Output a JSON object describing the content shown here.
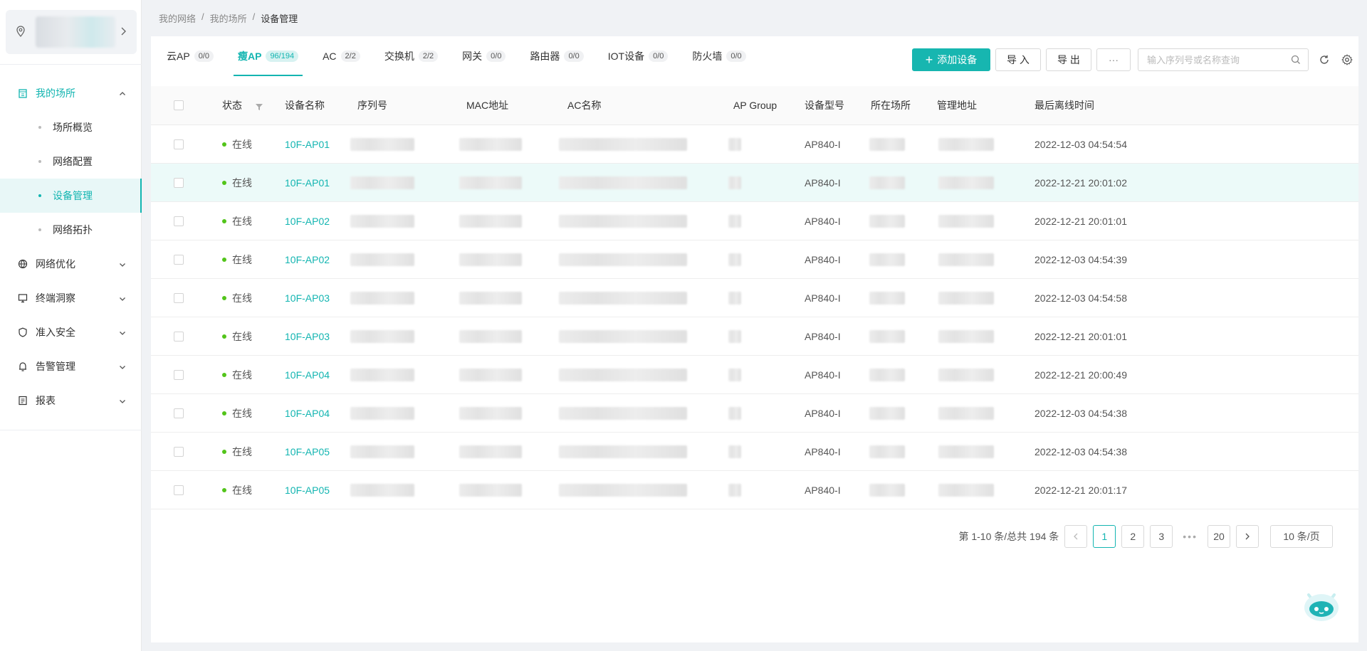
{
  "breadcrumb": [
    "我的网络",
    "我的场所",
    "设备管理"
  ],
  "sidebar": {
    "groups": [
      {
        "label": "我的场所",
        "icon": "building-icon",
        "open": true,
        "items": [
          "场所概览",
          "网络配置",
          "设备管理",
          "网络拓扑"
        ],
        "active": "设备管理"
      },
      {
        "label": "网络优化",
        "icon": "globe-icon"
      },
      {
        "label": "终端洞察",
        "icon": "monitor-icon"
      },
      {
        "label": "准入安全",
        "icon": "shield-icon"
      },
      {
        "label": "告警管理",
        "icon": "bell-icon"
      },
      {
        "label": "报表",
        "icon": "report-icon"
      }
    ]
  },
  "tabs": [
    {
      "label": "云AP",
      "count": "0/0"
    },
    {
      "label": "瘦AP",
      "count": "96/194",
      "active": true
    },
    {
      "label": "AC",
      "count": "2/2"
    },
    {
      "label": "交换机",
      "count": "2/2"
    },
    {
      "label": "网关",
      "count": "0/0"
    },
    {
      "label": "路由器",
      "count": "0/0"
    },
    {
      "label": "IOT设备",
      "count": "0/0"
    },
    {
      "label": "防火墙",
      "count": "0/0"
    }
  ],
  "toolbar": {
    "add_label": "添加设备",
    "import_label": "导 入",
    "export_label": "导 出",
    "more_label": "···",
    "search_placeholder": "输入序列号或名称查询"
  },
  "table": {
    "columns": [
      "状态",
      "设备名称",
      "序列号",
      "MAC地址",
      "AC名称",
      "AP Group",
      "设备型号",
      "所在场所",
      "管理地址",
      "最后离线时间"
    ],
    "rows": [
      {
        "status": "在线",
        "name": "10F-AP01",
        "model": "AP840-I",
        "last_offline": "2022-12-03 04:54:54"
      },
      {
        "status": "在线",
        "name": "10F-AP01",
        "model": "AP840-I",
        "last_offline": "2022-12-21 20:01:02"
      },
      {
        "status": "在线",
        "name": "10F-AP02",
        "model": "AP840-I",
        "last_offline": "2022-12-21 20:01:01"
      },
      {
        "status": "在线",
        "name": "10F-AP02",
        "model": "AP840-I",
        "last_offline": "2022-12-03 04:54:39"
      },
      {
        "status": "在线",
        "name": "10F-AP03",
        "model": "AP840-I",
        "last_offline": "2022-12-03 04:54:58"
      },
      {
        "status": "在线",
        "name": "10F-AP03",
        "model": "AP840-I",
        "last_offline": "2022-12-21 20:01:01"
      },
      {
        "status": "在线",
        "name": "10F-AP04",
        "model": "AP840-I",
        "last_offline": "2022-12-21 20:00:49"
      },
      {
        "status": "在线",
        "name": "10F-AP04",
        "model": "AP840-I",
        "last_offline": "2022-12-03 04:54:38"
      },
      {
        "status": "在线",
        "name": "10F-AP05",
        "model": "AP840-I",
        "last_offline": "2022-12-03 04:54:38"
      },
      {
        "status": "在线",
        "name": "10F-AP05",
        "model": "AP840-I",
        "last_offline": "2022-12-21 20:01:17"
      }
    ]
  },
  "pagination": {
    "summary": "第 1-10 条/总共 194 条",
    "pages": [
      "1",
      "2",
      "3"
    ],
    "last_page": "20",
    "current": "1",
    "page_size": "10 条/页"
  },
  "colors": {
    "accent": "#13b5b1",
    "online": "#52c41a"
  }
}
